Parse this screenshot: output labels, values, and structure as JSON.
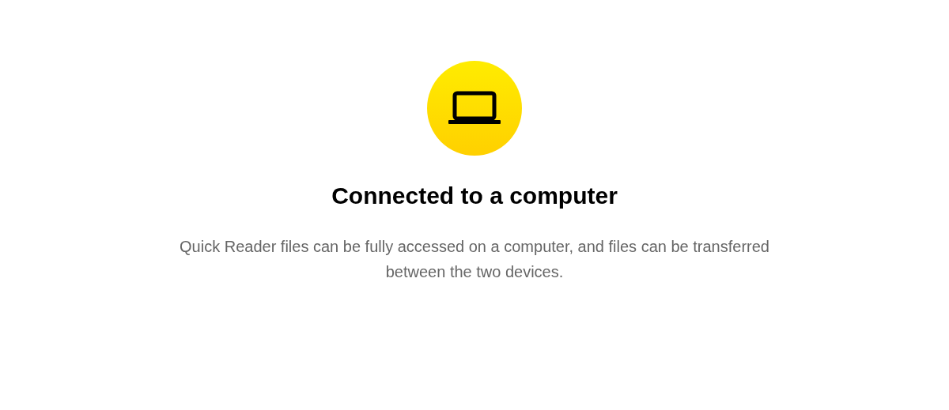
{
  "title": "Connected to a computer",
  "description": "Quick Reader files can be fully accessed on a computer, and files can be transferred between the two devices."
}
